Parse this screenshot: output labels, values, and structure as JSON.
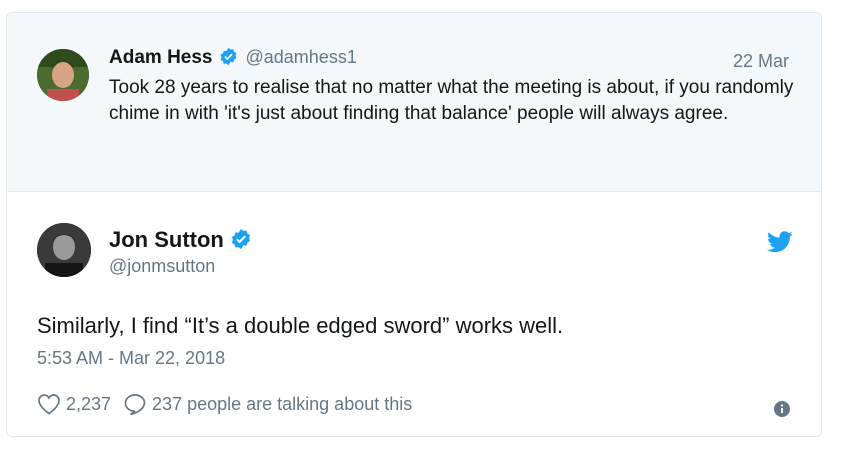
{
  "quoted_tweet": {
    "name": "Adam Hess",
    "handle": "@adamhess1",
    "date": "22 Mar",
    "text": "Took 28 years to realise that no matter what the meeting is about, if you randomly chime in with 'it's just about finding that balance' people will always agree."
  },
  "main_tweet": {
    "name": "Jon Sutton",
    "handle": "@jonmsutton",
    "text": "Similarly, I find “It’s a double edged sword” works well.",
    "timestamp": "5:53 AM - Mar 22, 2018",
    "likes": "2,237",
    "talking": "237 people are talking about this"
  },
  "colors": {
    "verified": "#1da1f2",
    "twitter_bird": "#1da1f2",
    "muted": "#657786"
  },
  "icons": [
    "verified-badge-icon",
    "twitter-bird-icon",
    "heart-icon",
    "reply-bubble-icon",
    "info-icon"
  ]
}
